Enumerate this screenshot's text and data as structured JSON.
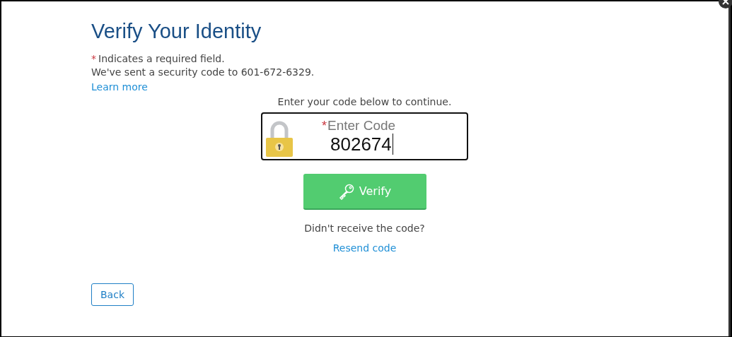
{
  "title": "Verify Your Identity",
  "required_note": {
    "marker": "*",
    "text": "Indicates a required field."
  },
  "message": "We've sent a security code to 601-672-6329.",
  "learn_more": "Learn more",
  "instruction": "Enter your code below to continue.",
  "code_field": {
    "marker": "*",
    "label": "Enter Code",
    "value": "802674"
  },
  "verify_button": "Verify",
  "resend_prompt": "Didn't receive the code?",
  "resend_link": "Resend code",
  "back_button": "Back"
}
